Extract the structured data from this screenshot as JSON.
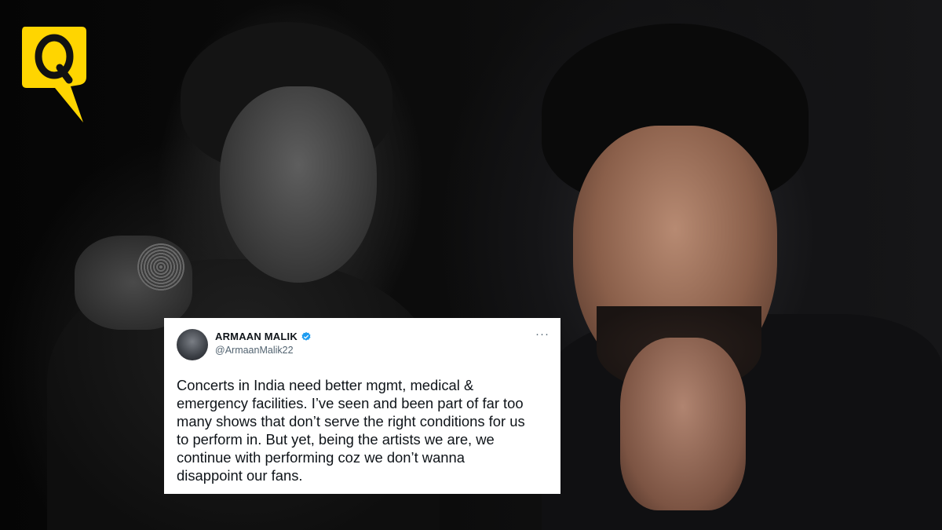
{
  "brand": {
    "logo_letter": "Q",
    "logo_color": "#ffd500"
  },
  "tweet": {
    "display_name": "ARMAAN MALIK",
    "verified": true,
    "verified_color": "#1d9bf0",
    "handle": "@ArmaanMalik22",
    "more_icon": "more-horizontal-icon",
    "more_glyph": "···",
    "text": "Concerts in India need better mgmt, medical &\nemergency facilities. I’ve seen and been part of far too\nmany shows that don’t serve the right conditions for us\nto perform in. But yet, being the artists we are, we\ncontinue with performing coz we don’t wanna\ndisappoint our fans."
  }
}
